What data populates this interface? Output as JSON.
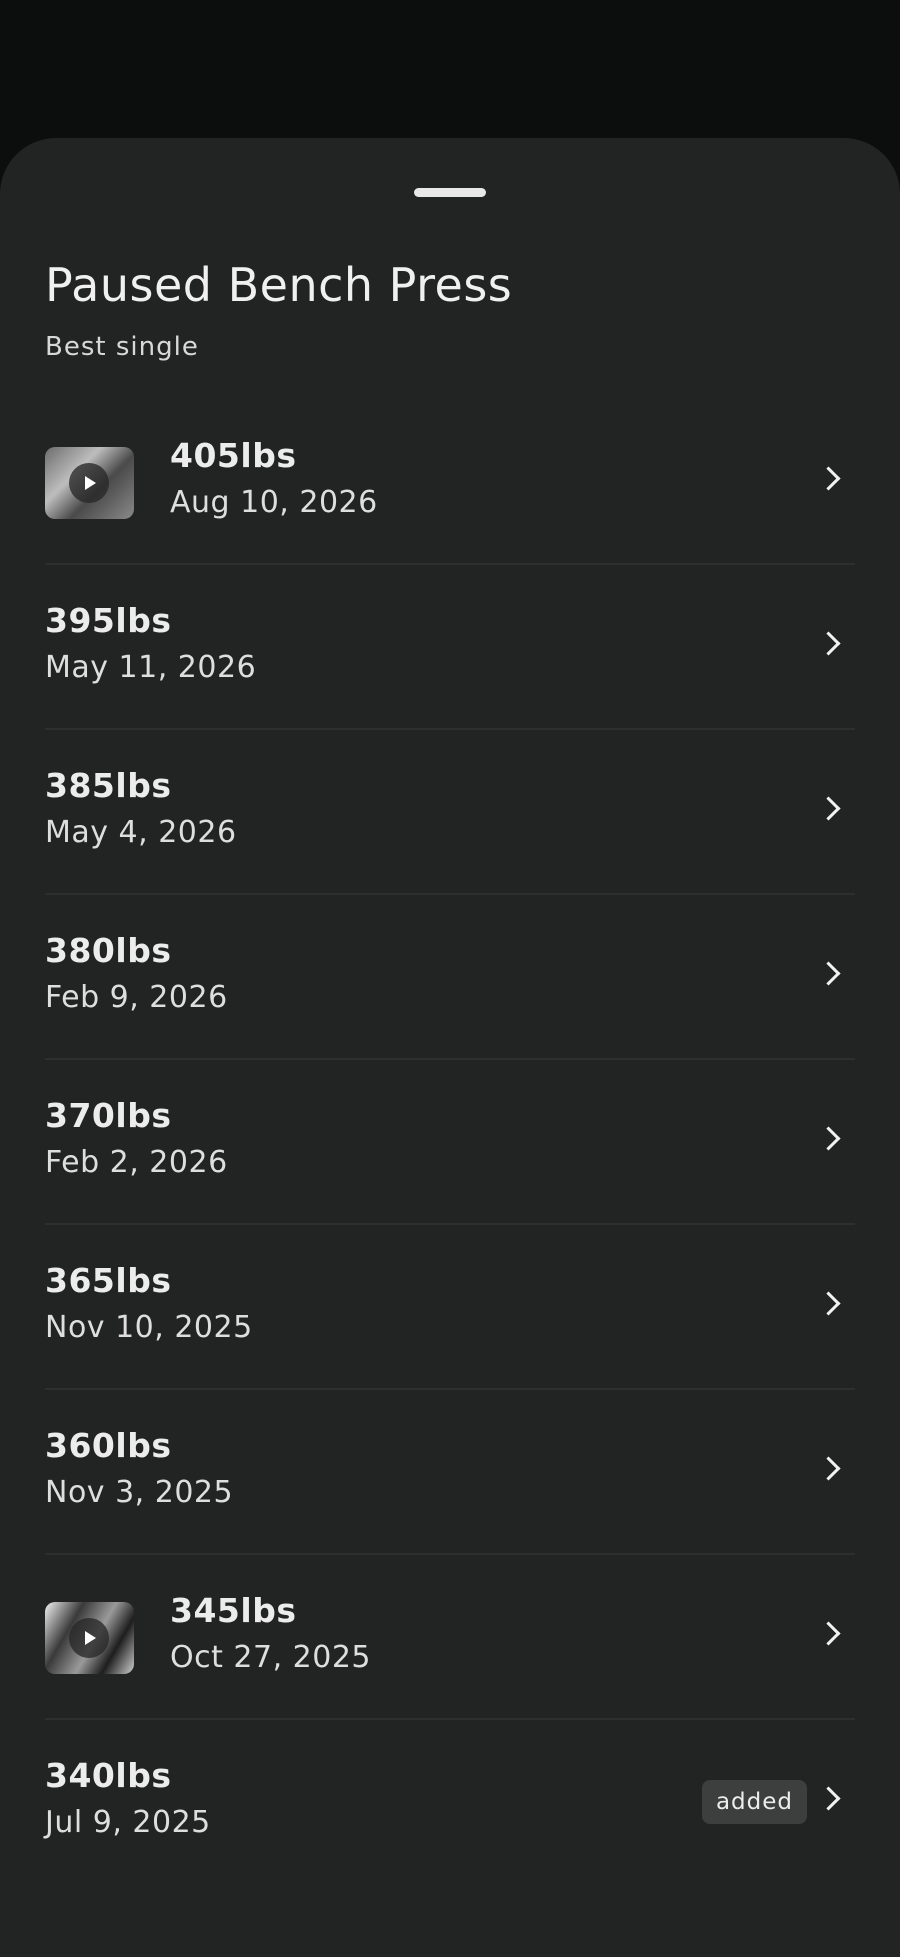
{
  "sheet": {
    "title": "Paused Bench Press",
    "subtitle": "Best single"
  },
  "icons": {
    "row_chevron": "chevron-right-icon",
    "video_play": "play-icon"
  },
  "records": [
    {
      "weight": "405lbs",
      "date": "Aug 10, 2026",
      "has_video": true,
      "badge": ""
    },
    {
      "weight": "395lbs",
      "date": "May 11, 2026",
      "has_video": false,
      "badge": ""
    },
    {
      "weight": "385lbs",
      "date": "May 4, 2026",
      "has_video": false,
      "badge": ""
    },
    {
      "weight": "380lbs",
      "date": "Feb 9, 2026",
      "has_video": false,
      "badge": ""
    },
    {
      "weight": "370lbs",
      "date": "Feb 2, 2026",
      "has_video": false,
      "badge": ""
    },
    {
      "weight": "365lbs",
      "date": "Nov 10, 2025",
      "has_video": false,
      "badge": ""
    },
    {
      "weight": "360lbs",
      "date": "Nov 3, 2025",
      "has_video": false,
      "badge": ""
    },
    {
      "weight": "345lbs",
      "date": "Oct 27, 2025",
      "has_video": true,
      "badge": ""
    },
    {
      "weight": "340lbs",
      "date": "Jul 9, 2025",
      "has_video": false,
      "badge": "added"
    }
  ]
}
